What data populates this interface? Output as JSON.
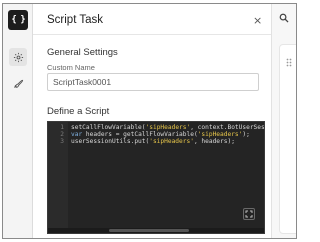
{
  "sidebar": {
    "logo_text": "{ }",
    "items": [
      {
        "icon": "gear-icon",
        "active": true
      },
      {
        "icon": "rocket-icon",
        "active": false
      }
    ]
  },
  "panel": {
    "title": "Script Task",
    "close_glyph": "×",
    "general_settings": {
      "title": "General Settings",
      "custom_name_label": "Custom Name",
      "custom_name_value": "ScriptTask0001"
    },
    "script": {
      "title": "Define a Script",
      "lines": [
        {
          "number": "1",
          "tokens": [
            {
              "t": "setCallFlowVariable(",
              "k": "fn"
            },
            {
              "t": "'sipHeaders'",
              "k": "str"
            },
            {
              "t": ", context.BotUserSessi",
              "k": "fn"
            }
          ]
        },
        {
          "number": "2",
          "tokens": [
            {
              "t": "var",
              "k": "kw"
            },
            {
              "t": " headers = getCallFlowVariable(",
              "k": "fn"
            },
            {
              "t": "'sipHeaders'",
              "k": "str"
            },
            {
              "t": ");",
              "k": "fn"
            }
          ]
        },
        {
          "number": "3",
          "tokens": [
            {
              "t": "userSessionUtils.put(",
              "k": "fn"
            },
            {
              "t": "'sipHeaders'",
              "k": "str"
            },
            {
              "t": ", headers);",
              "k": "fn"
            }
          ]
        }
      ]
    }
  },
  "canvas": {
    "search_icon": "search-icon"
  },
  "colors": {
    "editor_bg": "#242424",
    "keyword": "#7fb0e0",
    "string": "#e7c64a"
  }
}
